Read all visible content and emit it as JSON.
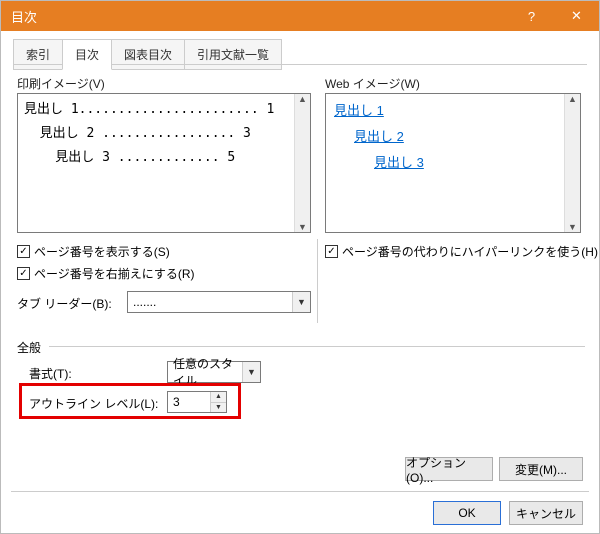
{
  "title": "目次",
  "tabs": [
    "索引",
    "目次",
    "図表目次",
    "引用文献一覧"
  ],
  "print_label": "印刷イメージ(V)",
  "web_label": "Web イメージ(W)",
  "print_lines": "見出し 1....................... 1\n  見出し 2 ................. 3\n    見出し 3 ............. 5",
  "web": {
    "l1": "見出し 1",
    "l2": "見出し 2",
    "l3": "見出し 3"
  },
  "cb_show_num": "ページ番号を表示する(S)",
  "cb_right_align": "ページ番号を右揃えにする(R)",
  "cb_hyperlink": "ページ番号の代わりにハイパーリンクを使う(H)",
  "tab_leader_label": "タブ リーダー(B):",
  "tab_leader_value": ".......",
  "general_label": "全般",
  "format_label": "書式(T):",
  "format_value": "任意のスタイル",
  "outline_label": "アウトライン レベル(L):",
  "outline_value": "3",
  "btn_options": "オプション(O)...",
  "btn_modify": "変更(M)...",
  "btn_ok": "OK",
  "btn_cancel": "キャンセル"
}
